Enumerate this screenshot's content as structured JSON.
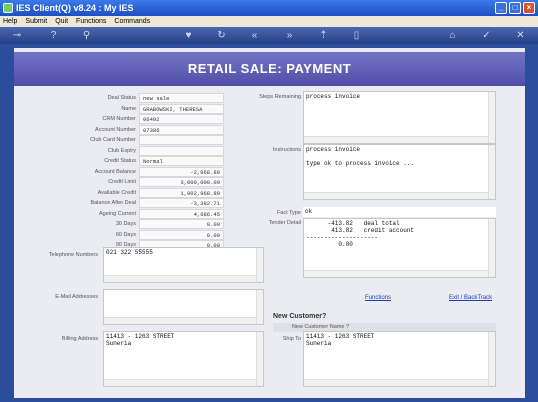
{
  "window": {
    "title": "IES Client(Q) v8.24 : My IES"
  },
  "menu": [
    "Help",
    "Submit",
    "Quit",
    "Functions",
    "Commands"
  ],
  "header": {
    "title": "RETAIL SALE: PAYMENT"
  },
  "fields": [
    {
      "label": "Deal Status",
      "value": "new sale",
      "align": "l"
    },
    {
      "label": "Name",
      "value": "GRABOWSKI, THERESA",
      "align": "l"
    },
    {
      "label": "CRM Number",
      "value": "06492",
      "align": "l"
    },
    {
      "label": "Account Number",
      "value": "07386",
      "align": "l"
    },
    {
      "label": "Club Card Number",
      "value": "",
      "align": "l"
    },
    {
      "label": "Club Expiry",
      "value": "",
      "align": "l"
    },
    {
      "label": "Credit Status",
      "value": "Normal",
      "align": "l"
    },
    {
      "label": "Account Balance",
      "value": "-2,968.89",
      "align": "r"
    },
    {
      "label": "Credit Limit",
      "value": "3,000,000.00",
      "align": "r"
    },
    {
      "label": "Available Credit",
      "value": "1,002,968.89",
      "align": "r"
    },
    {
      "label": "Balance After Deal",
      "value": "-3,382.71",
      "align": "r"
    },
    {
      "label": "Ageing Current",
      "value": "4,686.45",
      "align": "r"
    },
    {
      "label": "30 Days",
      "value": "0.00",
      "align": "r"
    },
    {
      "label": "60 Days",
      "value": "0.00",
      "align": "r"
    },
    {
      "label": "90 Days",
      "value": "0.00",
      "align": "r"
    }
  ],
  "telephone": {
    "label": "Telephone Numbers",
    "value": "021 322 55555"
  },
  "email": {
    "label": "E-Mail Addresses",
    "value": ""
  },
  "billing": {
    "label": "Billing Address",
    "value": "11413 - 1263 STREET\nSuneria"
  },
  "steps": {
    "label": "Steps Remaining",
    "value": "process invoice"
  },
  "instructions": {
    "label": "Instructions",
    "value": "process invoice\n\ntype ok to process invoice ..."
  },
  "fact_type": {
    "label": "Fact Type",
    "value": "ok"
  },
  "tender": {
    "label": "Tender Detail",
    "value": "      -413.82   deal total\n       413.82   credit account\n--------------------\n         0.00"
  },
  "links": {
    "functions": "Functions",
    "exit": "Exit / BackTrack"
  },
  "new_customer": {
    "title": "New Customer?",
    "name_label": "New Customer Name ?",
    "name_value": ""
  },
  "ship_to": {
    "label": "Ship To",
    "value": "11413 - 1263 STREET\nSuneria"
  },
  "toolbar_icons": [
    "key-icon",
    "help-icon",
    "search-icon",
    "heart-icon",
    "refresh-icon",
    "rewind-icon",
    "fast-forward-icon",
    "upload-icon",
    "document-icon",
    "home-icon",
    "check-icon",
    "close-icon"
  ]
}
